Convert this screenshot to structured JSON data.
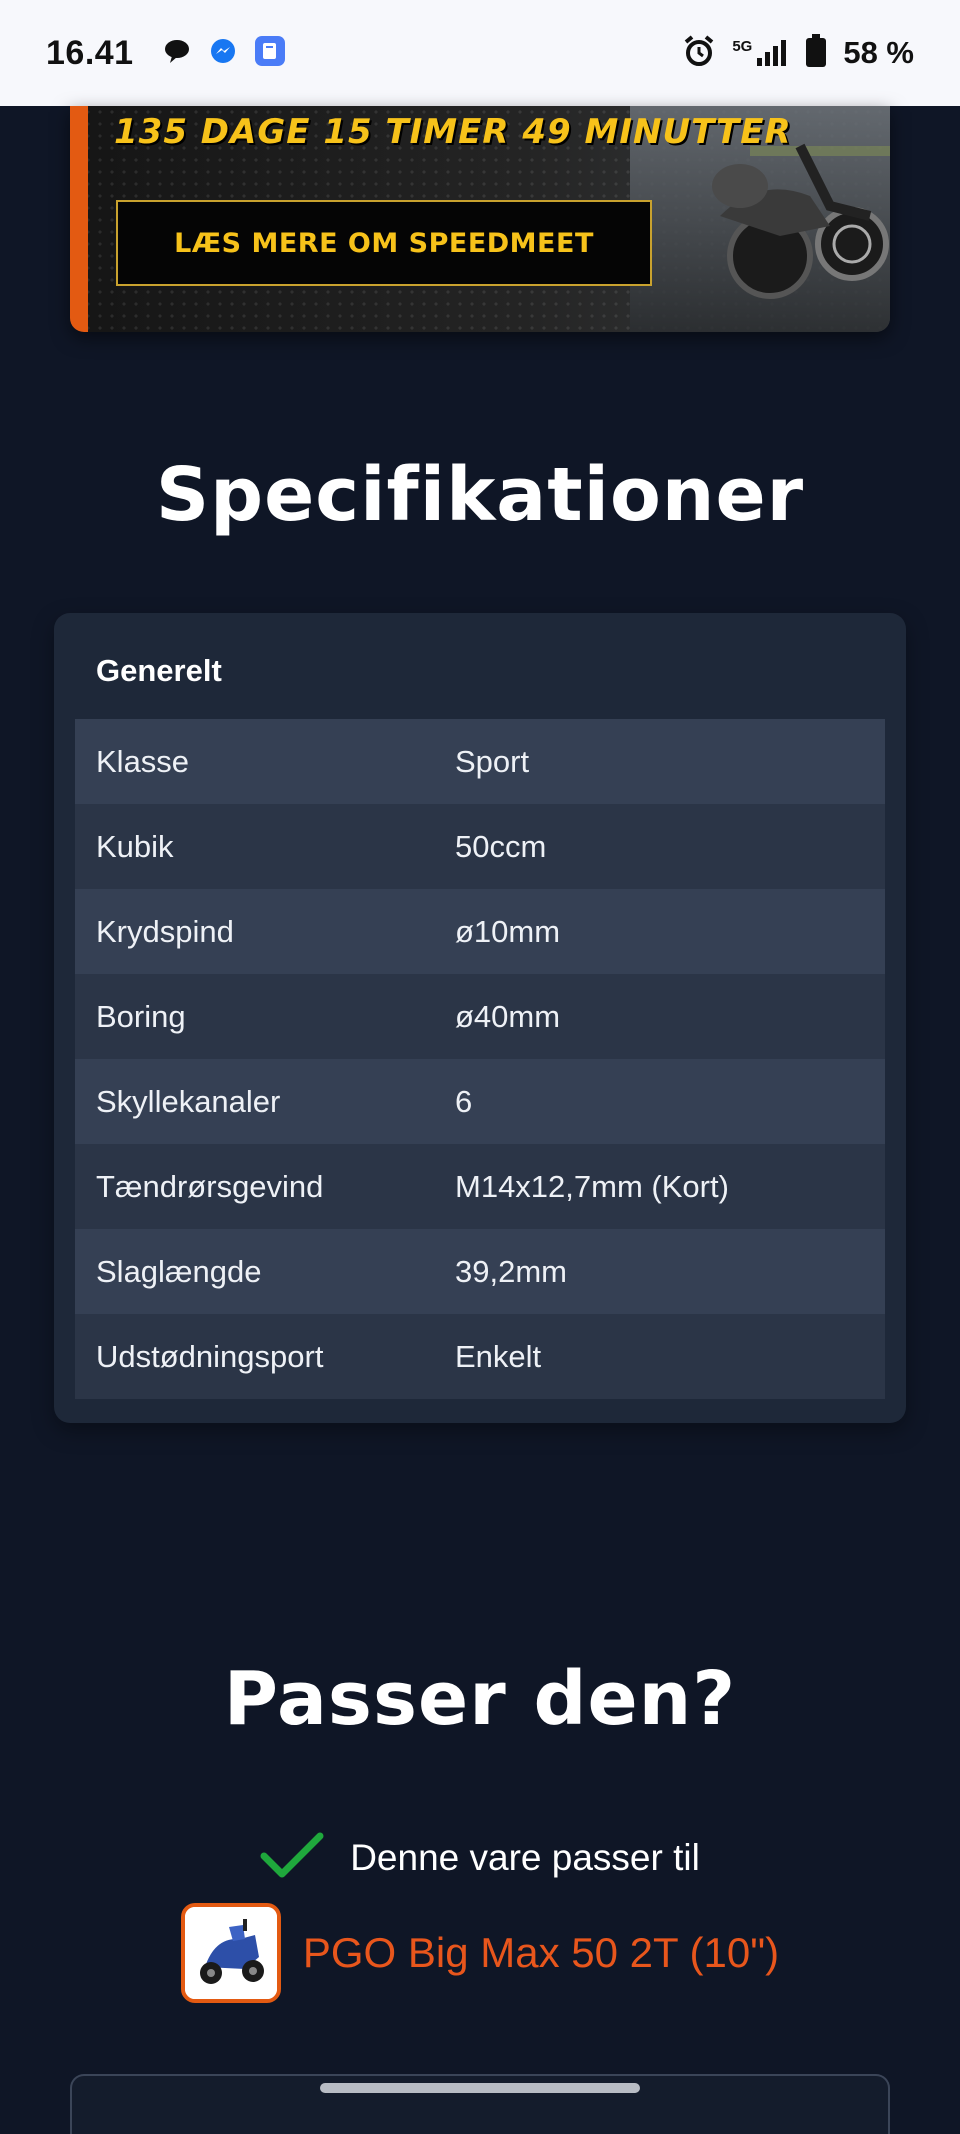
{
  "status_bar": {
    "time": "16.41",
    "network": "5G",
    "battery": "58 %",
    "icons": [
      "chat-bubble-icon",
      "messenger-icon",
      "app-icon",
      "alarm-icon",
      "signal-icon",
      "battery-icon"
    ]
  },
  "banner": {
    "countdown": "135 DAGE 15 TIMER 49 MINUTTER",
    "button_label": "LÆS MERE OM SPEEDMEET",
    "accent_color": "#f7c21a",
    "stripe_color": "#e35a12"
  },
  "specs": {
    "heading": "Specifikationer",
    "group_title": "Generelt",
    "rows": [
      {
        "key": "Klasse",
        "value": "Sport"
      },
      {
        "key": "Kubik",
        "value": "50ccm"
      },
      {
        "key": "Krydspind",
        "value": "ø10mm"
      },
      {
        "key": "Boring",
        "value": "ø40mm"
      },
      {
        "key": "Skyllekanaler",
        "value": "6"
      },
      {
        "key": "Tændrørsgevind",
        "value": "M14x12,7mm (Kort)"
      },
      {
        "key": "Slaglængde",
        "value": "39,2mm"
      },
      {
        "key": "Udstødningsport",
        "value": "Enkelt"
      }
    ]
  },
  "fit": {
    "heading": "Passer den?",
    "status_text": "Denne vare passer til",
    "vehicle_name": "PGO Big Max 50 2T (10\")",
    "link_color": "#e8561c",
    "check_color": "#1fa83c"
  }
}
